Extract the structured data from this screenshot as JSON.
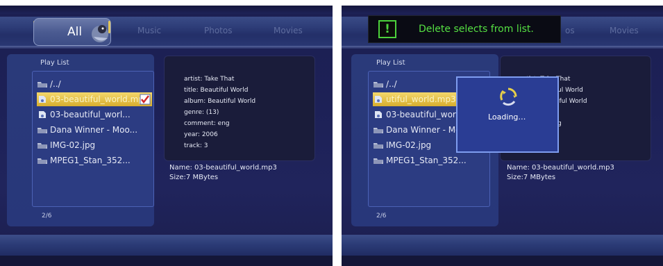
{
  "tabs": [
    "All",
    "Music",
    "Photos",
    "Movies"
  ],
  "right_tabs_visible": [
    "os",
    "Movies"
  ],
  "playlist": {
    "title": "Play List",
    "items": [
      {
        "label": "/../",
        "type": "folder"
      },
      {
        "label": "03-beautiful_world.mp",
        "type": "music",
        "selected": true
      },
      {
        "label": "03-beautiful_worl...",
        "type": "music"
      },
      {
        "label": "Dana Winner - Moo...",
        "type": "folder"
      },
      {
        "label": "IMG-02.jpg",
        "type": "folder"
      },
      {
        "label": "MPEG1_Stan_352...",
        "type": "folder"
      }
    ],
    "right_items": [
      {
        "label": "/../"
      },
      {
        "label": "utiful_world.mp3"
      },
      {
        "label": "03-beautiful_worl..."
      },
      {
        "label": "Dana Winner - Mo"
      },
      {
        "label": "IMG-02.jpg"
      },
      {
        "label": "MPEG1_Stan_352..."
      }
    ],
    "page": "2/6"
  },
  "info": {
    "artist": "artist: Take That",
    "title": "title: Beautiful World",
    "album": "album: Beautiful World",
    "genre": "genre: (13)",
    "comment": "comment: eng",
    "year": "year: 2006",
    "track": "track: 3",
    "right_artist": "artist: Take That",
    "right_title": "ul World",
    "right_album": "iful World",
    "right_genre": "g",
    "name": "Name: 03-beautiful_world.mp3",
    "size": "Size:7 MBytes"
  },
  "dialog": {
    "message": "Delete selects from list.",
    "icon": "exclamation-icon",
    "color": "#55e042"
  },
  "loading": {
    "label": "Loading…",
    "icon": "refresh-icon"
  }
}
